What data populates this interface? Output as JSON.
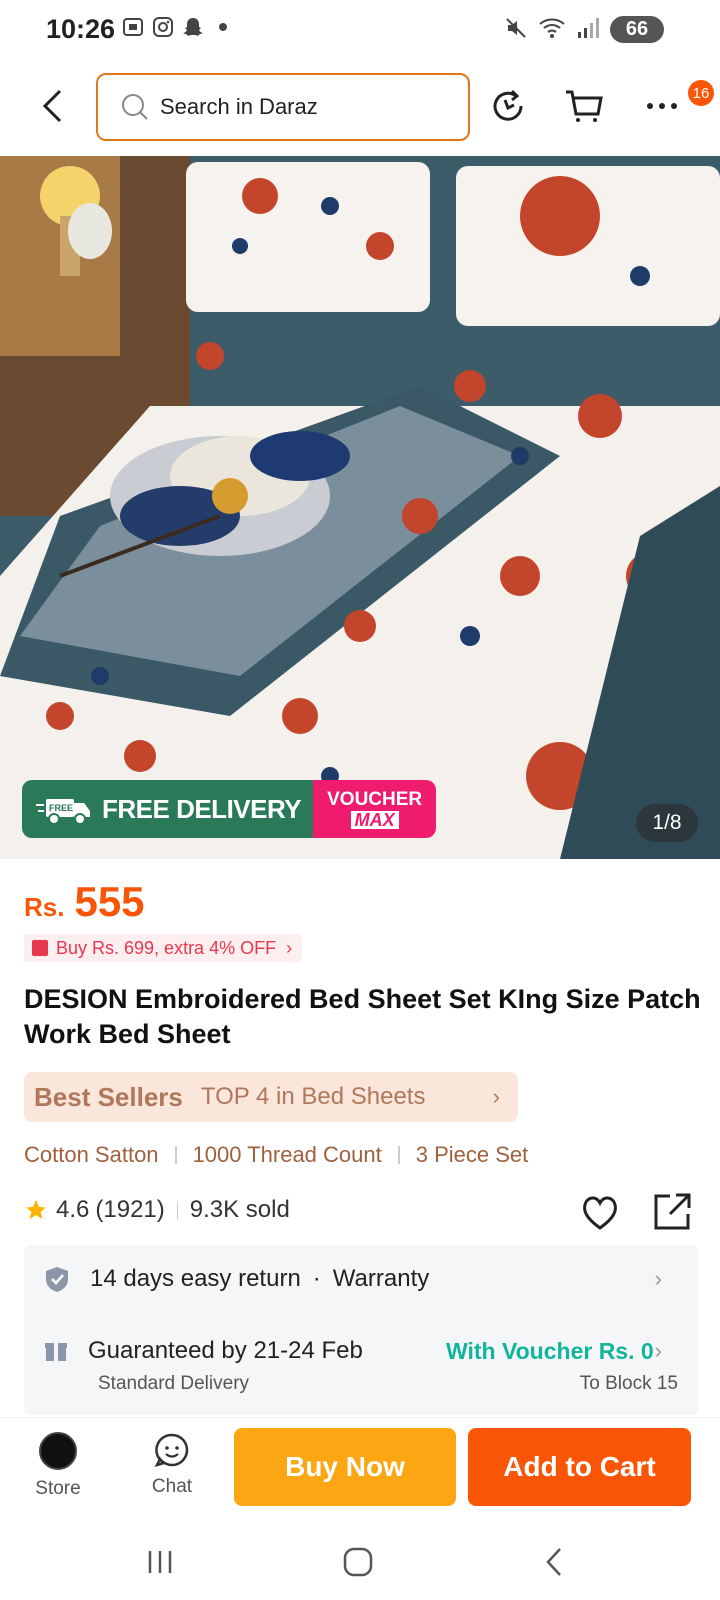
{
  "status_bar": {
    "time": "10:26",
    "battery": "66",
    "icons_left": [
      "screenshot-icon",
      "instagram-icon",
      "snapchat-icon",
      "dot-icon"
    ],
    "icons_right": [
      "mute-icon",
      "wifi-icon",
      "signal-icon",
      "battery-icon"
    ]
  },
  "header": {
    "search_placeholder": "Search in Daraz",
    "cart_badge": "16"
  },
  "hero": {
    "promo_free_label": "FREE DELIVERY",
    "promo_free_tag": "FREE",
    "promo_voucher_top": "VOUCHER",
    "promo_voucher_bottom": "MAX",
    "image_counter": "1/8"
  },
  "product": {
    "currency": "Rs.",
    "price": "555",
    "offer": "Buy Rs. 699, extra 4% OFF",
    "title": "DESION Embroidered Bed Sheet Set KIng Size Patch Work Bed Sheet",
    "bestseller_label": "Best Sellers",
    "bestseller_text": "TOP 4 in Bed Sheets",
    "attributes": [
      "Cotton Satton",
      "1000 Thread Count",
      "3 Piece Set"
    ],
    "rating": "4.6",
    "reviews": "(1921)",
    "sold": "9.3K sold"
  },
  "service": {
    "return": "14 days easy return",
    "warranty": "Warranty",
    "guarantee": "Guaranteed by 21-24 Feb",
    "voucher": "With Voucher Rs. 0",
    "delivery": "Standard Delivery",
    "location": "To Block 15"
  },
  "bottom_bar": {
    "store_label": "Store",
    "chat_label": "Chat",
    "buy_now": "Buy Now",
    "add_to_cart": "Add to Cart"
  },
  "colors": {
    "accent": "#f85606",
    "buy_now": "#fca614",
    "voucher_green": "#12b59b",
    "search_border": "#e4761b"
  }
}
